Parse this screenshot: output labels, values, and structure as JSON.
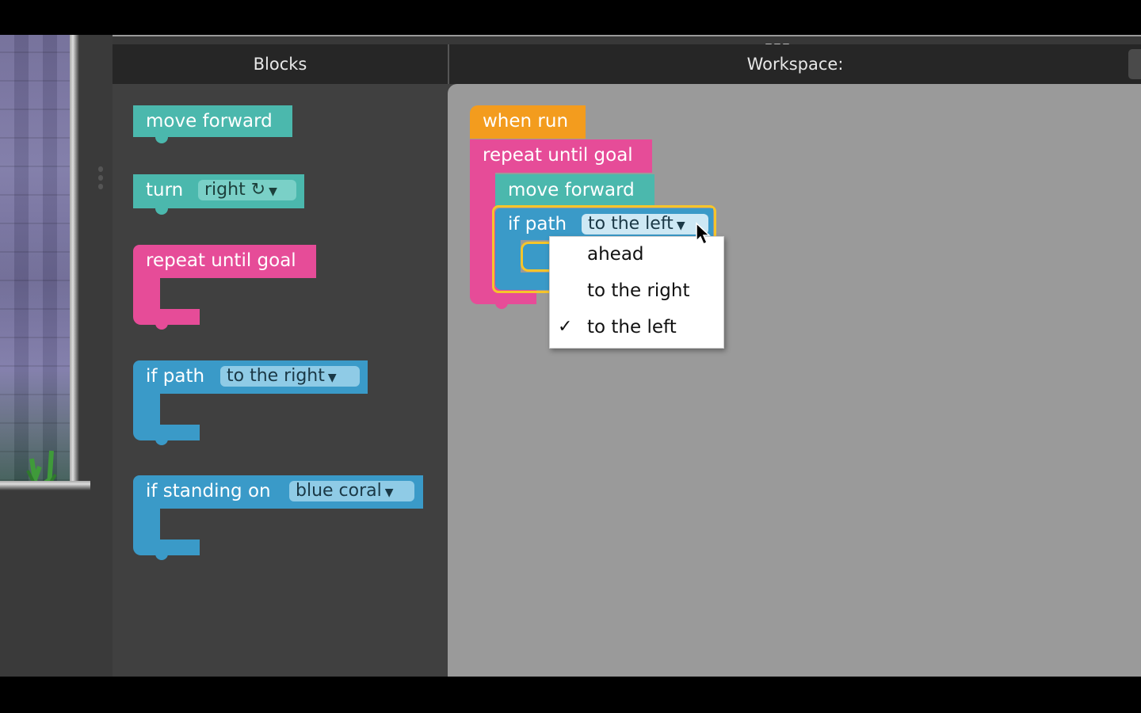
{
  "headers": {
    "blocks": "Blocks",
    "workspace": "Workspace:"
  },
  "toolbox": {
    "move_forward": "move forward",
    "turn": {
      "label": "turn",
      "field": "right ↻"
    },
    "repeat_until_goal": "repeat until goal",
    "if_path": {
      "label": "if path",
      "field": "to the right"
    },
    "if_standing_on": {
      "label": "if standing on",
      "field": "blue coral"
    }
  },
  "workspace": {
    "when_run": "when run",
    "repeat_until_goal": "repeat until goal",
    "move_forward": "move forward",
    "if_path": {
      "label": "if path",
      "field": "to the left"
    }
  },
  "dropdown": {
    "options": [
      {
        "label": "ahead",
        "checked": false
      },
      {
        "label": "to the right",
        "checked": false
      },
      {
        "label": "to the left",
        "checked": true
      }
    ],
    "check_mark": "✓"
  },
  "icons": {
    "dropdown_arrow": "▼"
  },
  "colors": {
    "motion": "#4bb8ad",
    "loop": "#e64c98",
    "logic": "#3a9ac8",
    "event": "#f39c1e",
    "highlight": "#f6c52a",
    "workspace_bg": "#9a9a9a",
    "toolbox_bg": "#404040"
  }
}
